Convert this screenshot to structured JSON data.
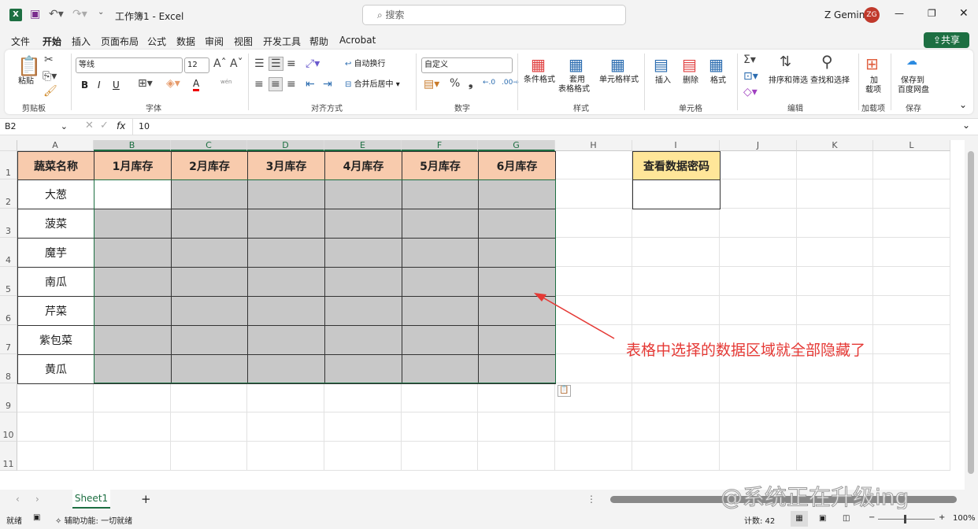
{
  "title": {
    "doc": "工作簿1 - Excel",
    "search": "搜索",
    "user": "Z Gemini",
    "initials": "ZG"
  },
  "menu": [
    "文件",
    "开始",
    "插入",
    "页面布局",
    "公式",
    "数据",
    "审阅",
    "视图",
    "开发工具",
    "帮助",
    "Acrobat"
  ],
  "share": "共享",
  "ribbon": {
    "paste": "粘贴",
    "clipboard": "剪贴板",
    "font_name": "等线",
    "font_size": "12",
    "font": "字体",
    "bold": "B",
    "italic": "I",
    "underline": "U",
    "font_color": "A",
    "phonetic": "wén",
    "wrap": "自动换行",
    "merge": "合并后居中",
    "align": "对齐方式",
    "num_format": "自定义",
    "percent": "%",
    "comma": "❟",
    "number": "数字",
    "cond": "条件格式",
    "table1": "套用",
    "table2": "表格格式",
    "cellstyle": "单元格样式",
    "styles": "样式",
    "insert": "插入",
    "delete": "删除",
    "format": "格式",
    "cells": "单元格",
    "sort": "排序和筛选",
    "find": "查找和选择",
    "editing": "编辑",
    "addin1": "加",
    "addin2": "载项",
    "addins": "加载项",
    "save1": "保存到",
    "save2": "百度网盘",
    "save": "保存"
  },
  "formula": {
    "namebox": "B2",
    "fx": "fx",
    "value": "10"
  },
  "columns": [
    "A",
    "B",
    "C",
    "D",
    "E",
    "F",
    "G",
    "H",
    "I",
    "J",
    "K",
    "L"
  ],
  "rows": [
    "1",
    "2",
    "3",
    "4",
    "5",
    "6",
    "7",
    "8",
    "9",
    "10",
    "11"
  ],
  "headers": [
    "蔬菜名称",
    "1月库存",
    "2月库存",
    "3月库存",
    "4月库存",
    "5月库存",
    "6月库存"
  ],
  "vegetables": [
    "大葱",
    "菠菜",
    "魔芋",
    "南瓜",
    "芹菜",
    "紫包菜",
    "黄瓜"
  ],
  "password_label": "查看数据密码",
  "annotation": "表格中选择的数据区域就全部隐藏了",
  "sheet_tab": "Sheet1",
  "status": {
    "ready": "就绪",
    "accessibility": "辅助功能: 一切就绪",
    "count": "计数: 42",
    "zoom": "100%"
  },
  "watermark": "@系统正在升级ing",
  "colors": {
    "accent": "#1d6f42",
    "header": "#f8cbad",
    "hidden": "#c8c8c8",
    "password": "#ffe699",
    "arrow": "#e53935"
  }
}
